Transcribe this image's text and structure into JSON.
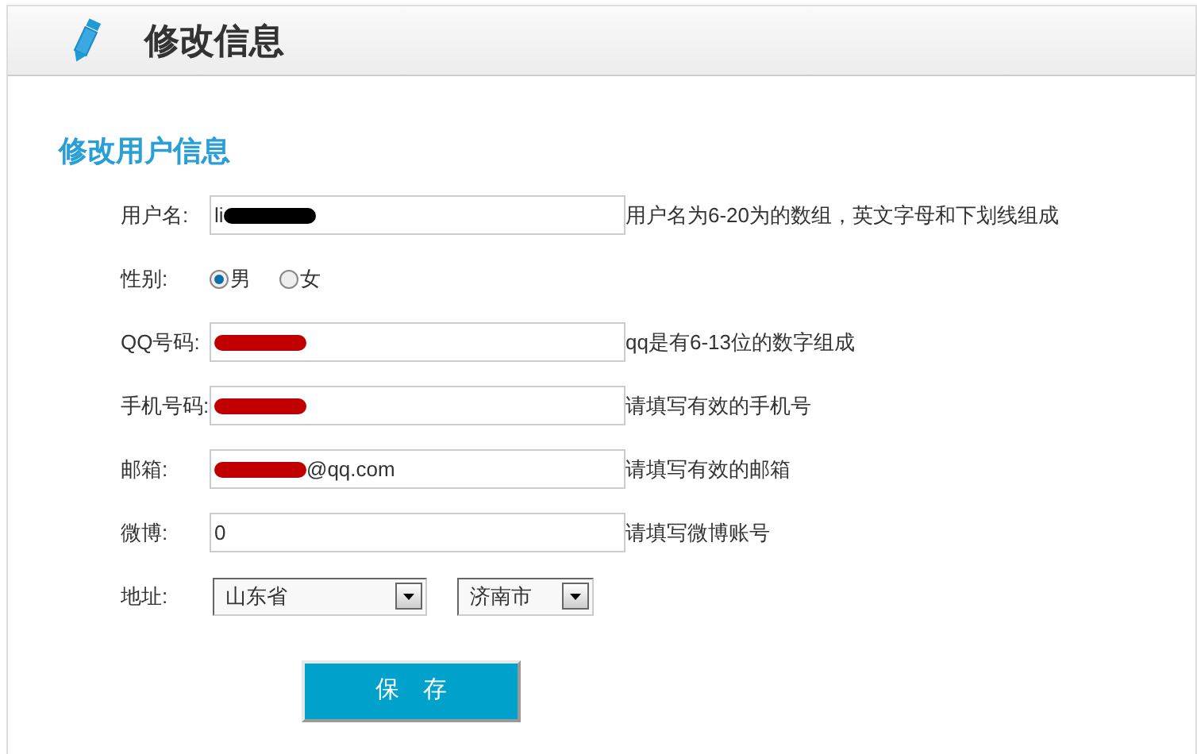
{
  "header": {
    "title": "修改信息"
  },
  "section_title": "修改用户信息",
  "fields": [
    {
      "kind": "text",
      "label": "用户名:",
      "parts": [
        {
          "kind": "text",
          "text": "li"
        },
        {
          "kind": "redaction",
          "color": "#000000"
        }
      ],
      "hint": "用户名为6-20为的数组，英文字母和下划线组成"
    },
    {
      "kind": "radio",
      "label": "性别:",
      "options": [
        {
          "label": "男",
          "selected": true
        },
        {
          "label": "女",
          "selected": false
        }
      ]
    },
    {
      "kind": "text",
      "label": "QQ号码:",
      "parts": [
        {
          "kind": "redaction",
          "color": "#c00000"
        }
      ],
      "hint": "qq是有6-13位的数字组成"
    },
    {
      "kind": "text",
      "label": "手机号码:",
      "parts": [
        {
          "kind": "redaction",
          "color": "#c00000"
        }
      ],
      "hint": "请填写有效的手机号"
    },
    {
      "kind": "text",
      "label": "邮箱:",
      "parts": [
        {
          "kind": "redaction",
          "color": "#c00000"
        },
        {
          "kind": "text",
          "text": "@qq.com"
        }
      ],
      "hint": "请填写有效的邮箱"
    },
    {
      "kind": "text",
      "label": "微博:",
      "parts": [
        {
          "kind": "text",
          "text": "0"
        }
      ],
      "hint": "请填写微博账号"
    },
    {
      "kind": "selects",
      "label": "地址:",
      "selects": [
        "山东省",
        "济南市"
      ]
    }
  ],
  "save_button": "保　存"
}
